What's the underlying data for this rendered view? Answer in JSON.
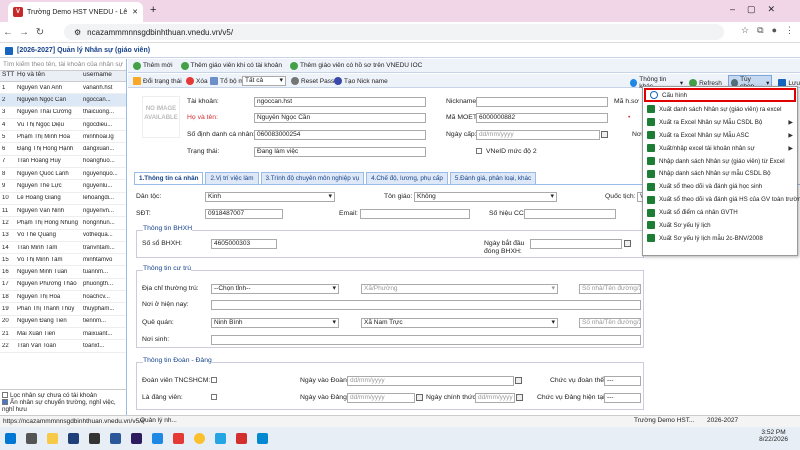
{
  "browser": {
    "tab_title": "Trường Demo HST VNEDU - Lê",
    "url": "ncazammmnnsgdbinhthuan.vnedu.vn/v5/"
  },
  "app": {
    "title": "[2026-2027] Quản lý Nhân sự (giáo viên)"
  },
  "toolbar1": {
    "add": "Thêm mới",
    "add_acc": "Thêm giáo viên khi có tài khoản",
    "add_vn": "Thêm giáo viên có hồ sơ trên VNEDU IOC"
  },
  "toolbar2": {
    "change": "Đổi trạng thái",
    "delete": "Xóa",
    "dept_label": "Tổ bộ môn:",
    "dept_value": "Tất cả",
    "reset": "Reset Pass",
    "nick": "Tạo Nick name",
    "info": "Thông tin khác",
    "refresh": "Refresh",
    "options": "Tùy chọn",
    "save": "Lưu"
  },
  "left": {
    "search_placeholder": "Tìm kiếm theo tên, tài khoản của nhân sự",
    "cols": [
      "STT",
      "Họ và tên",
      "username"
    ],
    "rows": [
      [
        "1",
        "Nguyễn Văn Anh",
        "vananh.hst"
      ],
      [
        "2",
        "Nguyễn Ngọc Cần",
        "ngoccan..."
      ],
      [
        "3",
        "Nguyễn Thái Cường",
        "thaicuong..."
      ],
      [
        "4",
        "Vũ Thị Ngọc Diệu",
        "ngocdieu..."
      ],
      [
        "5",
        "Phạm Thị Minh Hòa",
        "minhhoai.lg"
      ],
      [
        "6",
        "Đặng Thị Hồng Hạnh",
        "dangxuan..."
      ],
      [
        "7",
        "Trần Hoàng Huy",
        "hoanghuo..."
      ],
      [
        "8",
        "Nguyễn Quốc Lanh",
        "nguyenquo..."
      ],
      [
        "9",
        "Nguyễn Thế Lực",
        "nguyenlu..."
      ],
      [
        "10",
        "Lê Hoàng Giang",
        "lehoangdi..."
      ],
      [
        "11",
        "Nguyễn Văn Ninh",
        "nguyenvn..."
      ],
      [
        "12",
        "Phạm Thị Hồng Nhung",
        "hongnhun..."
      ],
      [
        "13",
        "Võ Thế Quang",
        "vothequa..."
      ],
      [
        "14",
        "Trần Minh Tâm",
        "tranvntam..."
      ],
      [
        "15",
        "Võ Thị Minh Tâm",
        "minhtamvo"
      ],
      [
        "16",
        "Nguyễn Minh Tuấn",
        "tuannm..."
      ],
      [
        "17",
        "Nguyễn Phương Thảo",
        "phuongth..."
      ],
      [
        "18",
        "Nguyễn Thị Hoa",
        "hoachcv..."
      ],
      [
        "19",
        "Phan Thị Thanh Thủy",
        "thuypham..."
      ],
      [
        "20",
        "Nguyễn Đăng Tiến",
        "tiennm..."
      ],
      [
        "21",
        "Mai Xuân Tiến",
        "maixuant..."
      ],
      [
        "22",
        "Trần Văn Toàn",
        "toanxt..."
      ]
    ],
    "filter1": "Lọc nhân sự chưa có tài khoản",
    "filter2": "Ẩn nhân sự chuyển trường, nghỉ việc, nghỉ hưu"
  },
  "form": {
    "noimage": "NO IMAGE AVAILABLE",
    "account_l": "Tài khoản:",
    "account_v": "ngoccan.hst",
    "name_l": "Họ và tên:",
    "name_v": "Nguyễn Ngọc Cần",
    "id_l": "Số định danh cá nhân:",
    "id_v": "060083000254",
    "status_l": "Trạng thái:",
    "status_v": "Đang làm việc",
    "nick_l": "Nickname:",
    "moet_l": "Mã MOET:",
    "moet_v": "6000000882",
    "issue_l": "Ngày cấp:",
    "issue_v": "dd/mm/yyyy",
    "vneid_l": "VNeID mức độ 2",
    "mahs_l": "Mã h.sơ",
    "noi_l": "Nơi",
    "tabs": [
      "1.Thông tin cá nhân",
      "2.Vị trí việc làm",
      "3.Trình độ chuyên môn nghiệp vụ",
      "4.Chế độ, lương, phụ cấp",
      "5.Đánh giá, phân loại, khác"
    ],
    "ethnic_l": "Dân tộc:",
    "ethnic_v": "Kinh",
    "religion_l": "Tôn giáo:",
    "religion_v": "Không",
    "nation_l": "Quốc tịch:",
    "nation_v": "Vi",
    "phone_l": "SĐT:",
    "phone_v": "0918487007",
    "email_l": "Email:",
    "cc_l": "Số hiệu CC:",
    "bhxh_t": "Thông tin BHXH",
    "bhxh_l": "Số sổ BHXH:",
    "bhxh_v": "4605000303",
    "bhxh_date_l": "Ngày bắt đầu đóng BHXH:",
    "res_t": "Thông tin cư trú",
    "perm_l": "Địa chỉ thường trú:",
    "perm_v": "--Chọn tỉnh--",
    "ward_v": "Xã/Phường",
    "street_v": "Số nhà/Tên đường/Xóm/Thôn",
    "cur_l": "Nơi ở hiện nay:",
    "home_l": "Quê quán:",
    "home_v": "Ninh Bình",
    "home_ward": "Xã Nam Trực",
    "birth_l": "Nơi sinh:",
    "party_t": "Thông tin Đoàn - Đảng",
    "youth_l": "Đoàn viên TNCSHCM:",
    "youth_date_l": "Ngày vào Đoàn:",
    "youth_pos_l": "Chức vụ đoàn thể:",
    "party_l": "Là đảng viên:",
    "party_date_l": "Ngày vào Đảng:",
    "official_l": "Ngày chính thức:",
    "party_pos_l": "Chức vụ Đảng hiện tại:",
    "date_ph": "dd/mm/yyyy",
    "dash": "---"
  },
  "menu": {
    "items": [
      "Cấu hình",
      "Xuất danh sách Nhân sự (giáo viên) ra excel",
      "Xuất ra Excel Nhân sự Mẫu CSDL Bộ",
      "Xuất ra Excel Nhân sự Mẫu ASC",
      "Xuất/nhập excel tài khoản nhân sự",
      "Nhập danh sách Nhân sự (giáo viên) từ Excel",
      "Nhập danh sách Nhân sự mẫu CSDL Bộ",
      "Xuất sổ theo dõi và đánh giá học sinh",
      "Xuất sổ theo dõi và đánh giá HS của GV toàn trường",
      "Xuất sổ điểm cá nhân GVTH",
      "Xuất Sơ yếu lý lịch",
      "Xuất Sơ yếu lý lịch mẫu 2c-BNV/2008"
    ]
  },
  "status": {
    "url": "https://ncazammmnnsgdbinhthuan.vnedu.vn/v5/#",
    "tab1": "Trường Demo HST...",
    "tab2": "2026-2027",
    "tab3": "Quản lý nh..."
  },
  "taskbar": {
    "time": "3:52 PM",
    "date": "8/22/2026"
  }
}
